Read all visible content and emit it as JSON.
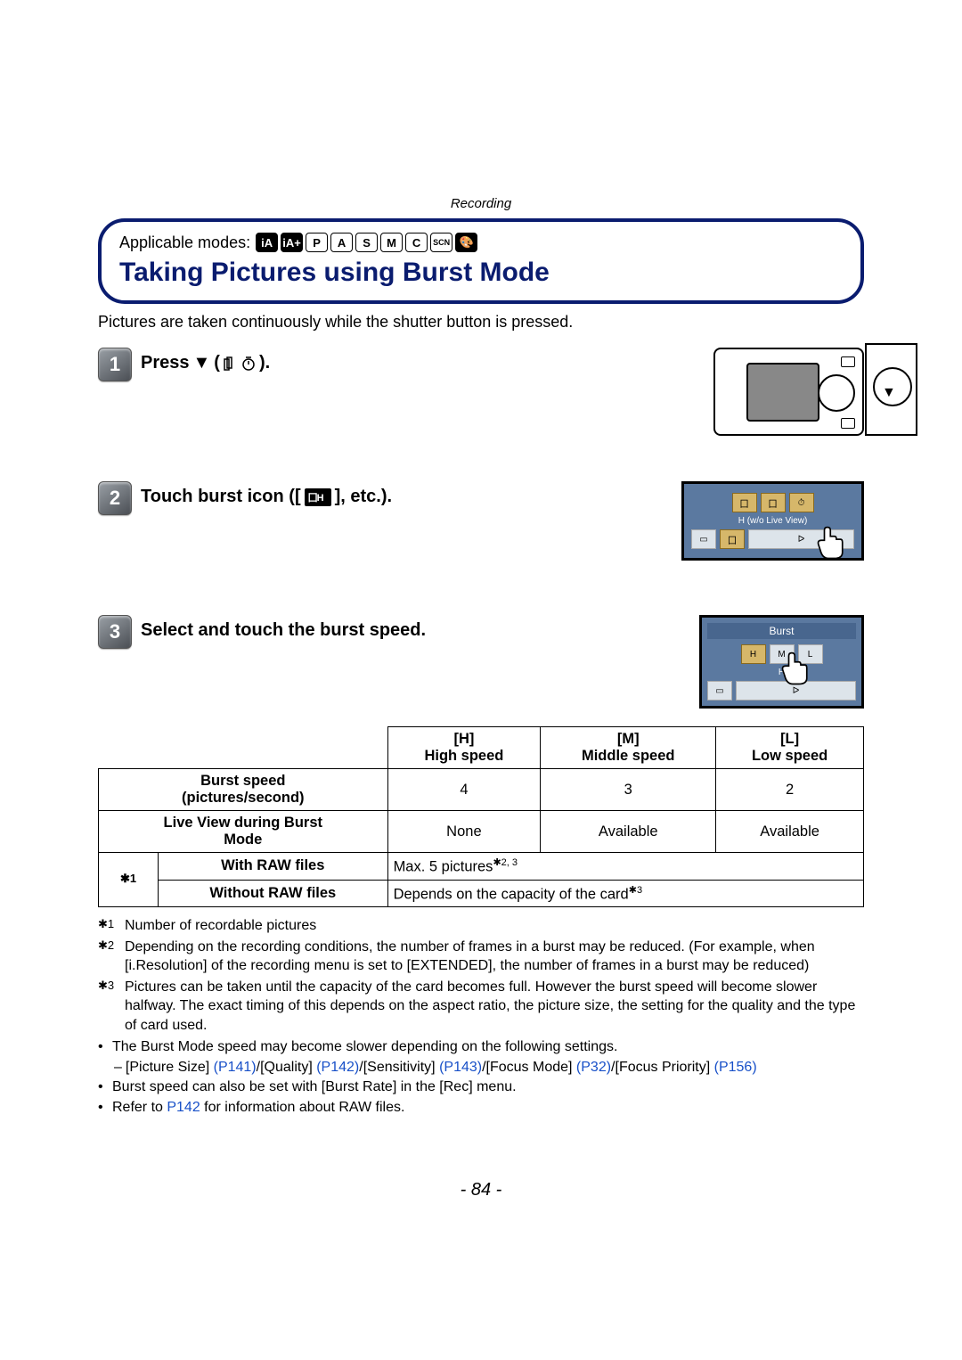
{
  "header": {
    "section": "Recording",
    "applicable_label": "Applicable modes:",
    "modes": [
      "iA",
      "iA+",
      "P",
      "A",
      "S",
      "M",
      "C",
      "SCN",
      "🎨"
    ],
    "page_title": "Taking Pictures using Burst Mode"
  },
  "intro": "Pictures are taken continuously while the shutter button is pressed.",
  "steps": {
    "s1": {
      "num": "1",
      "text_pre": "Press ",
      "symbol": "▼",
      "text_post": " (",
      "icon_hint": "□ ⏱",
      "text_end": ")."
    },
    "s2": {
      "num": "2",
      "text_pre": "Touch burst icon ([",
      "text_post": "], etc.)."
    },
    "s3": {
      "num": "3",
      "text": "Select and touch the burst speed."
    }
  },
  "lcd": {
    "header2": "Burst",
    "sub2": "H (w/o Live View)",
    "header3": "Burst",
    "sub3": "H"
  },
  "table": {
    "col_h": {
      "code": "[H]",
      "label": "High speed"
    },
    "col_m": {
      "code": "[M]",
      "label": "Middle speed"
    },
    "col_l": {
      "code": "[L]",
      "label": "Low speed"
    },
    "row1_label": "Burst speed",
    "row1_sub": "(pictures/second)",
    "row1_h": "4",
    "row1_m": "3",
    "row1_l": "2",
    "row2_label": "Live View during Burst",
    "row2_sub": "Mode",
    "row2_h": "None",
    "row2_m": "Available",
    "row2_l": "Available",
    "row3_merge_marker": "✱1",
    "row3a_label": "With RAW files",
    "row3a_val": "Max. 5 pictures",
    "row3a_sup": "✱2, 3",
    "row3b_label": "Without RAW files",
    "row3b_val": "Depends on the capacity of the card",
    "row3b_sup": "✱3"
  },
  "footnotes": {
    "f1": {
      "marker": "✱1",
      "text": "Number of recordable pictures"
    },
    "f2": {
      "marker": "✱2",
      "text": "Depending on the recording conditions, the number of frames in a burst may be reduced. (For example, when [i.Resolution] of the recording menu is set to [EXTENDED], the number of frames in a burst may be reduced)"
    },
    "f3": {
      "marker": "✱3",
      "text": "Pictures can be taken until the capacity of the card becomes full. However the burst speed will become slower halfway. The exact timing of this depends on the aspect ratio, the picture size, the setting for the quality and the type of card used."
    }
  },
  "bullets": {
    "b1": "The Burst Mode speed may become slower depending on the following settings.",
    "b1_sub_pre": "[Picture Size] ",
    "b1_refs": {
      "p141": "(P141)",
      "p142": "(P142)",
      "p143": "(P143)",
      "p32": "(P32)",
      "p156": "(P156)"
    },
    "b1_sub_parts": {
      "quality": "/[Quality] ",
      "sensitivity": "/[Sensitivity] ",
      "focusmode": "/[Focus Mode] ",
      "focuspriority": "/[Focus Priority] "
    },
    "b2": "Burst speed can also be set with [Burst Rate] in the [Rec] menu.",
    "b3_pre": "Refer to ",
    "b3_ref": "P142",
    "b3_post": " for information about RAW files."
  },
  "page_number": "- 84 -"
}
